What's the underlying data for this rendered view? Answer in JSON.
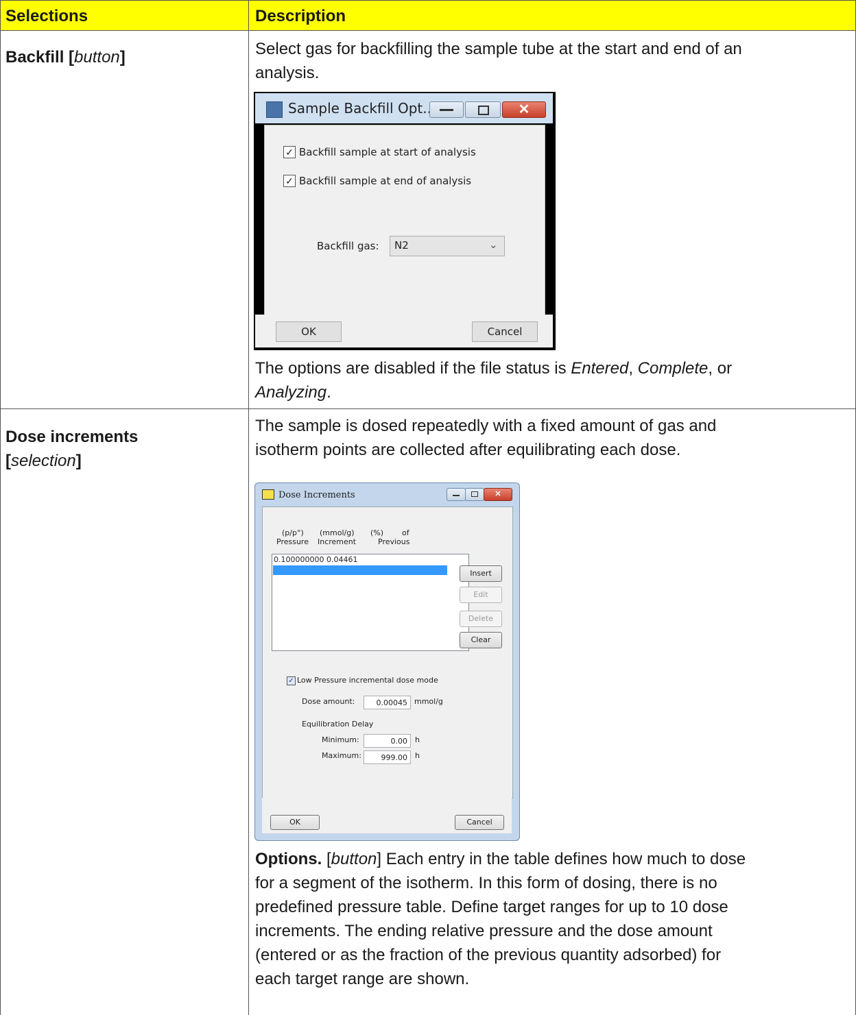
{
  "header": {
    "col1": "Selections",
    "col2": "Description"
  },
  "row1": {
    "selection_name": "Backfill [",
    "selection_type": "button",
    "selection_close": "]",
    "desc_line1": "Select gas for backfilling the sample tube at the start and end of an",
    "desc_line2": "analysis.",
    "note_prefix": "The options are disabled if the file status is ",
    "note_status1": "Entered",
    "note_sep1": ", ",
    "note_status2": "Complete",
    "note_sep2": ", or",
    "note_status3": "Analyzing",
    "note_end": "."
  },
  "dialog1": {
    "title": "Sample Backfill Opt...",
    "check_start_label": "Backfill sample at start of analysis",
    "check_end_label": "Backfill sample at end of analysis",
    "gas_label": "Backfill gas:",
    "gas_value": "N2",
    "ok_label": "OK",
    "cancel_label": "Cancel"
  },
  "row2": {
    "selection_line1": "Dose increments",
    "selection_open": "[",
    "selection_type": "selection",
    "selection_close": "]",
    "desc_line1": "The sample is dosed repeatedly with a fixed amount of gas and",
    "desc_line2": "isotherm points are collected after equilibrating each dose.",
    "options_label": "Options.",
    "options_open": " [",
    "options_type": "button",
    "options_text1": "] Each entry in the table defines how much to dose",
    "options_text2": "for a segment of the isotherm. In this form of dosing, there is no",
    "options_text3": "predefined pressure table. Define target ranges for up to 10 dose",
    "options_text4": "increments. The ending relative pressure and the dose amount",
    "options_text5": "(entered or as the fraction of the previous quantity adsorbed) for",
    "options_text6": "each target range are shown."
  },
  "dialog2": {
    "title": "Dose Increments",
    "col_pressure_unit": "(p/p°)",
    "col_pressure": "Pressure",
    "col_increment_unit": "(mmol/g)",
    "col_increment": "Increment",
    "col_percent_unit": "(%)",
    "col_of": "of",
    "col_previous": "Previous",
    "row_value": "0.100000000  0.04461",
    "insert_label": "Insert",
    "edit_label": "Edit",
    "delete_label": "Delete",
    "clear_label": "Clear",
    "low_pressure_label": "Low Pressure incremental dose mode",
    "dose_amount_label": "Dose amount:",
    "dose_amount_value": "0.00045",
    "dose_amount_unit": "mmol/g",
    "equil_label": "Equilibration Delay",
    "minimum_label": "Minimum:",
    "minimum_value": "0.00",
    "minimum_unit": "h",
    "maximum_label": "Maximum:",
    "maximum_value": "999.00",
    "maximum_unit": "h",
    "ok_label": "OK",
    "cancel_label": "Cancel"
  }
}
